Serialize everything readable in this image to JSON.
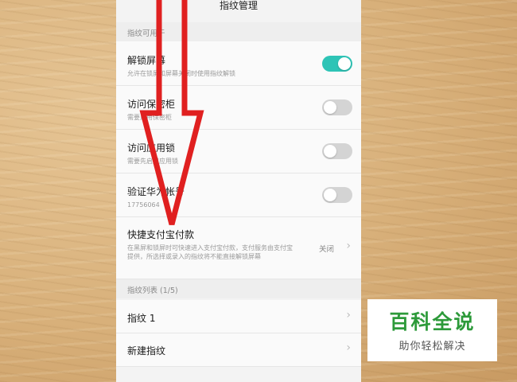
{
  "screen": {
    "title": "指纹管理",
    "section_usage": "指纹可用于",
    "rows": [
      {
        "title": "解锁屏幕",
        "subtitle": "允许在锁屏和屏幕关闭时使用指纹解锁",
        "toggle": "on"
      },
      {
        "title": "访问保密柜",
        "subtitle": "需要启用保密柜",
        "toggle": "off"
      },
      {
        "title": "访问应用锁",
        "subtitle": "需要先启用应用锁",
        "toggle": "off"
      },
      {
        "title": "验证华为帐号",
        "subtitle": "17756064",
        "toggle": "off"
      }
    ],
    "alipay": {
      "title": "快捷支付宝付款",
      "subtitle": "在黑屏和锁屏时可快速进入支付宝付款，支付服务由支付宝提供，所选择或录入的指纹将不能直接解锁屏幕",
      "value": "关闭"
    },
    "section_list": "指纹列表 (1/5)",
    "list": [
      {
        "label": "指纹 1"
      },
      {
        "label": "新建指纹"
      }
    ]
  },
  "watermark": {
    "title": "百科全说",
    "subtitle": "助你轻松解决"
  },
  "colors": {
    "toggle_on": "#2ec4b6",
    "toggle_off": "#d4d4d4",
    "arrow": "#e02020",
    "watermark_green": "#2d9a3a"
  }
}
